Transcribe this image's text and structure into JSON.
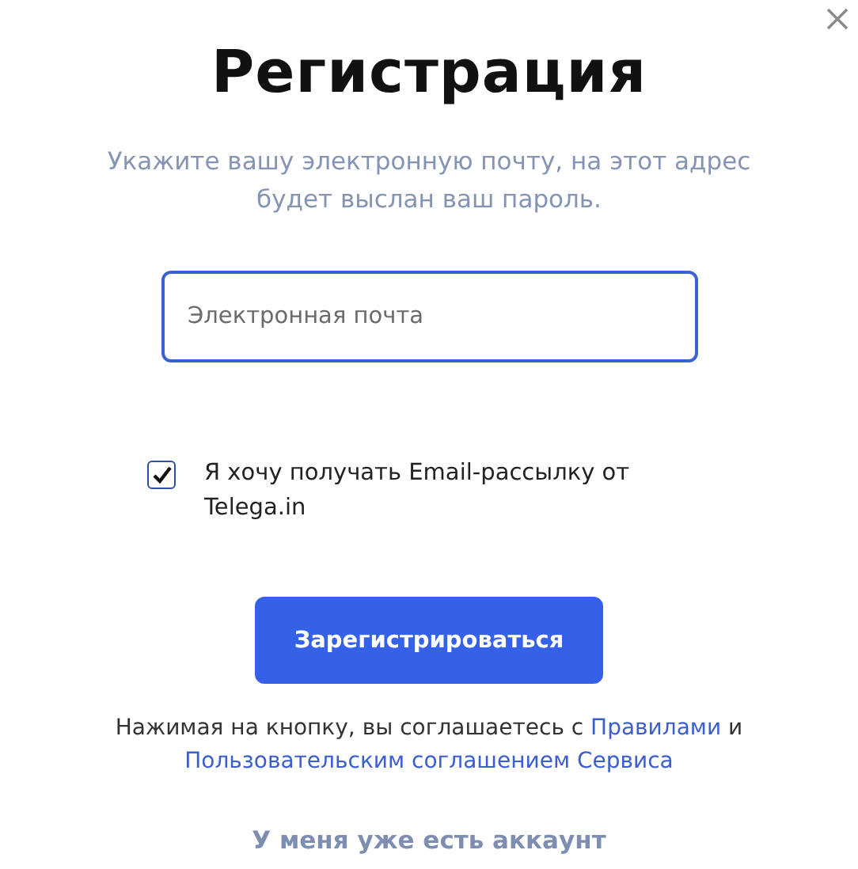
{
  "title": "Регистрация",
  "subtitle": "Укажите вашу электронную почту, на этот адрес будет выслан ваш пароль.",
  "email_field": {
    "placeholder": "Электронная почта"
  },
  "newsletter": {
    "label": "Я хочу получать Email-рассылку от Telega.in",
    "checked": true
  },
  "submit_button": "Зарегистрироваться",
  "terms": {
    "text": "Нажимая на кнопку, вы соглашаетесь с",
    "rules_link": "Правилами",
    "joiner": "и",
    "agreement_link": "Пользовательским соглашением Сервиса"
  },
  "login_link": "У меня уже есть аккаунт"
}
